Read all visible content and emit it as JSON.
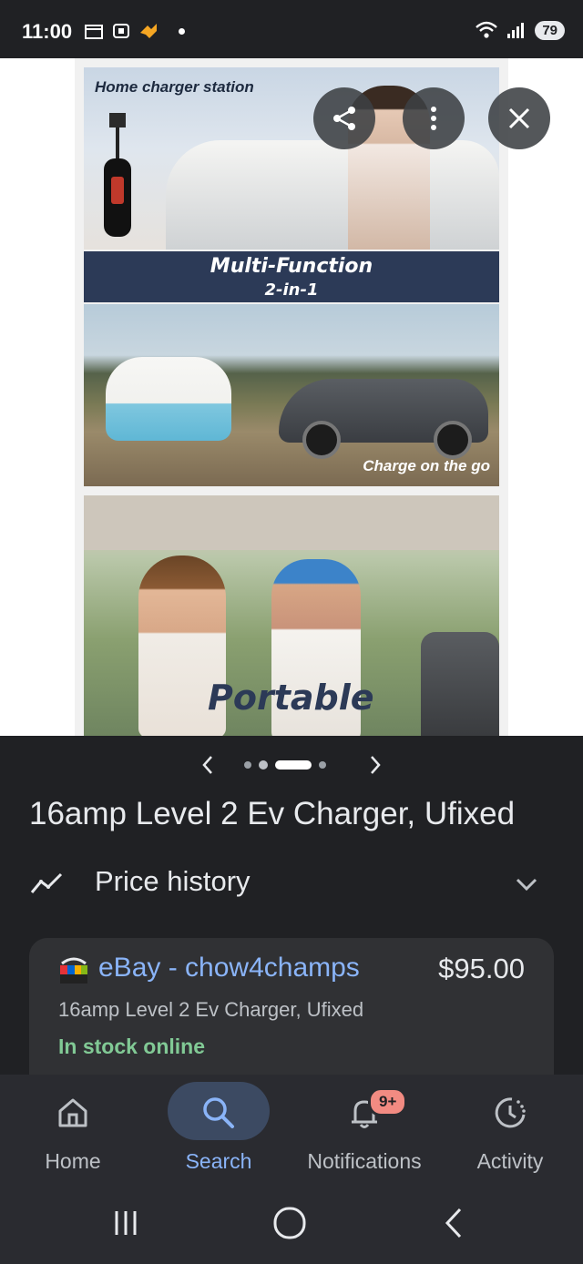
{
  "status_bar": {
    "time": "11:00",
    "battery": "79"
  },
  "viewer": {
    "image_texts": {
      "home_charger": "Home charger station",
      "banner_line1": "Multi-Function",
      "banner_line2": "2-in-1",
      "charge_on_go": "Charge on the go",
      "portable": "Portable"
    },
    "share_icon": "share-icon",
    "more_icon": "more-vert-icon",
    "close_icon": "close-icon"
  },
  "carousel": {
    "prev_icon": "chevron-left-icon",
    "next_icon": "chevron-right-icon",
    "dot_count": 5,
    "active_index": 2
  },
  "product": {
    "title": "16amp Level 2 Ev Charger, Ufixed"
  },
  "price_history": {
    "label": "Price history",
    "icon": "trend-icon",
    "expand_icon": "chevron-down-icon"
  },
  "offer": {
    "store": "eBay - chow4champs",
    "price": "$95.00",
    "title": "16amp Level 2 Ev Charger, Ufixed",
    "stock": "In stock online"
  },
  "bottom_nav": {
    "items": [
      {
        "label": "Home",
        "icon": "home-icon"
      },
      {
        "label": "Search",
        "icon": "search-icon"
      },
      {
        "label": "Notifications",
        "icon": "bell-icon",
        "badge": "9+"
      },
      {
        "label": "Activity",
        "icon": "activity-icon"
      }
    ],
    "active_index": 1
  },
  "system_nav": {
    "recents_icon": "recents-icon",
    "home_icon": "home-circle-icon",
    "back_icon": "back-icon"
  },
  "colors": {
    "background": "#202124",
    "link": "#8ab4f8",
    "stock": "#81c995",
    "badge": "#f28b82",
    "banner": "#2c3a57"
  }
}
